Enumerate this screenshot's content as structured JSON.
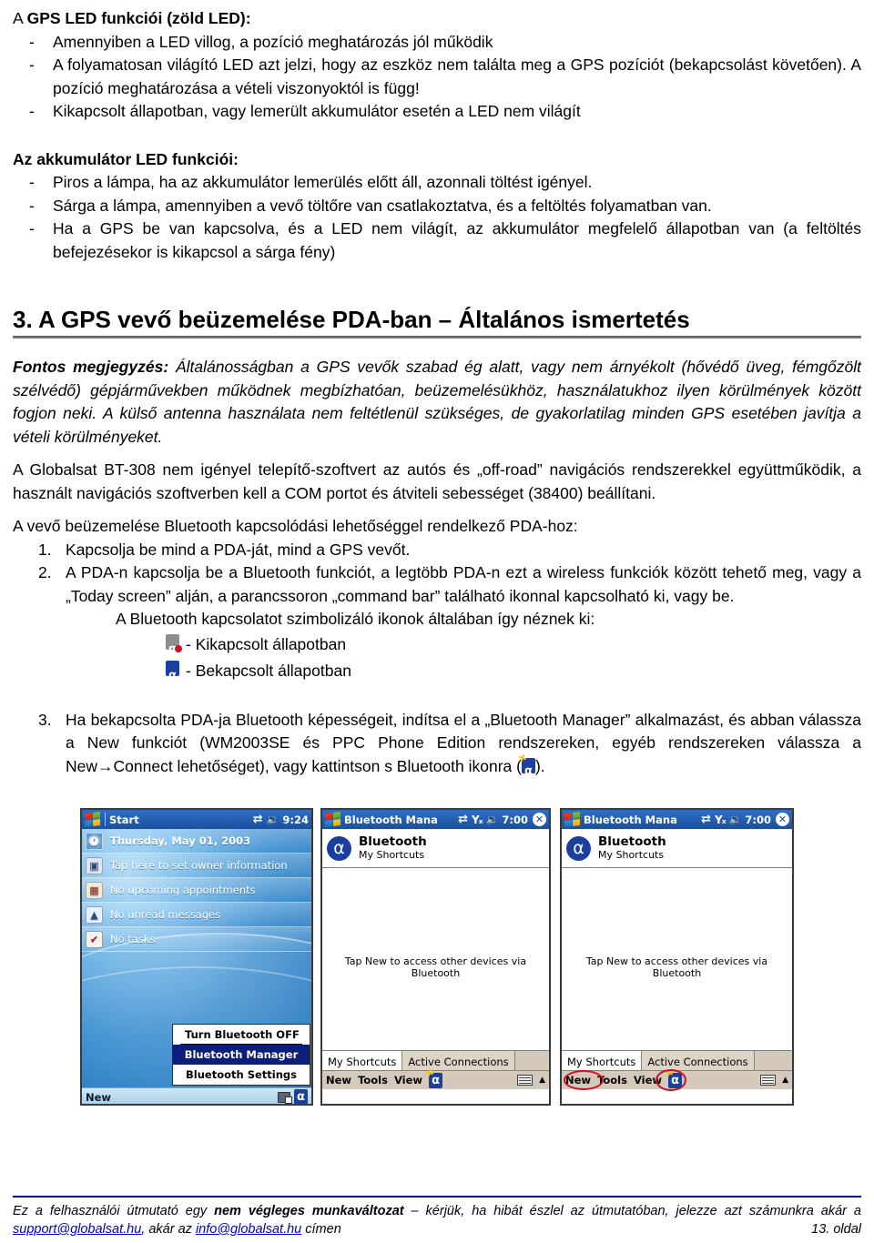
{
  "gps_led": {
    "heading_prefix": "A ",
    "heading_bold": "GPS LED funkciói (zöld LED):",
    "items": [
      "Amennyiben a LED villog, a pozíció meghatározás jól működik",
      "A folyamatosan világító LED azt jelzi, hogy az eszköz nem találta meg a GPS pozíciót (bekapcsolást követően). A pozíció meghatározása a vételi viszonyoktól is függ!",
      "Kikapcsolt állapotban, vagy lemerült akkumulátor esetén a LED nem világít"
    ]
  },
  "battery_led": {
    "heading": "Az akkumulátor LED funkciói:",
    "items": [
      "Piros a lámpa, ha az akkumulátor lemerülés előtt áll, azonnali töltést igényel.",
      "Sárga a lámpa, amennyiben a vevő töltőre van csatlakoztatva, és a feltöltés folyamatban van.",
      "Ha a GPS be van kapcsolva, és a LED nem világít, az akkumulátor megfelelő állapotban van (a feltöltés befejezésekor is kikapcsol a sárga fény)"
    ]
  },
  "section3": {
    "title": "3. A GPS vevő beüzemelése PDA-ban – Általános ismertetés",
    "note_label": "Fontos megjegyzés:",
    "note_body": " Általánosságban a GPS vevők szabad ég alatt, vagy nem árnyékolt (hővédő üveg, fémgőzölt szélvédő) gépjárművekben működnek megbízhatóan, beüzemelésükhöz, használatukhoz ilyen körülmények között fogjon neki. A külső antenna használata nem feltétlenül szükséges, de gyakorlatilag minden GPS esetében javítja a vételi körülményeket.",
    "para2": "A Globalsat BT-308 nem igényel telepítő-szoftvert az autós és „off-road” navigációs rendszerekkel együttműködik, a használt navigációs szoftverben kell a COM portot és átviteli sebességet (38400) beállítani.",
    "para3": "A vevő beüzemelése Bluetooth kapcsolódási lehetőséggel rendelkező PDA-hoz:",
    "steps": [
      {
        "num": "1.",
        "text": "Kapcsolja be mind a PDA-ját, mind a GPS vevőt."
      },
      {
        "num": "2.",
        "text": "A PDA-n kapcsolja be a Bluetooth funkciót, a legtöbb PDA-n ezt a wireless funkciók között tehető meg, vagy a „Today screen” alján, a parancssoron „command bar” található ikonnal kapcsolható ki, vagy be."
      }
    ],
    "icon_intro": "A Bluetooth kapcsolatot szimbolizáló ikonok általában így néznek ki:",
    "icon_rows": [
      {
        "icon": "bluetooth-off-icon",
        "label": "- Kikapcsolt állapotban"
      },
      {
        "icon": "bluetooth-on-icon",
        "label": "- Bekapcsolt állapotban"
      }
    ],
    "step3": {
      "num": "3.",
      "text_a": "Ha bekapcsolta PDA-ja Bluetooth képességeit, indítsa el a „Bluetooth Manager” alkalmazást, és abban válassza a New funkciót (WM2003SE és PPC Phone Edition rendszereken, egyéb rendszereken válassza a New→Connect lehetőséget), vagy kattintson s Bluetooth ikonra (",
      "text_b": ")."
    }
  },
  "pda1": {
    "name": "today-screen",
    "titlebar": {
      "logo": "windows-logo-icon",
      "start": "Start",
      "icons": [
        "sync-icon",
        "speaker-icon"
      ],
      "clock": "9:24"
    },
    "rows": [
      {
        "icon": "clock-icon",
        "label": "Thursday, May 01, 2003"
      },
      {
        "icon": "owner-info-icon",
        "label": "Tap here to set owner information"
      },
      {
        "icon": "calendar-icon",
        "label": "No upcoming appointments"
      },
      {
        "icon": "inbox-icon",
        "label": "No unread messages"
      },
      {
        "icon": "tasks-icon",
        "label": "No tasks"
      }
    ],
    "popup": [
      {
        "label": "Turn Bluetooth OFF",
        "selected": false,
        "sep": true
      },
      {
        "label": "Bluetooth Manager",
        "selected": true,
        "sep": false
      },
      {
        "label": "Bluetooth Settings",
        "selected": false,
        "sep": false
      }
    ],
    "cmdbar": {
      "new": "New",
      "icons": [
        "network-icon",
        "bluetooth-on-icon"
      ]
    }
  },
  "pda2": {
    "name": "bluetooth-manager-screen",
    "titlebar": {
      "title": "Bluetooth Mana",
      "icons": [
        "sync-icon",
        "signal-off-icon",
        "speaker-icon"
      ],
      "clock": "7:00",
      "close": "✕"
    },
    "header": {
      "title": "Bluetooth",
      "subtitle": "My Shortcuts",
      "icon": "bluetooth-on-icon"
    },
    "hint": "Tap New to access other devices via Bluetooth",
    "tabs": [
      {
        "label": "My Shortcuts",
        "active": true
      },
      {
        "label": "Active Connections",
        "active": false
      }
    ],
    "cmdbar": {
      "items": [
        "New",
        "Tools",
        "View"
      ],
      "icon": "bluetooth-spark-icon",
      "keyboard": "keyboard-icon",
      "arrow": "▲"
    },
    "rings": []
  },
  "pda3": {
    "name": "bluetooth-manager-screen-annotated",
    "titlebar": {
      "title": "Bluetooth Mana",
      "icons": [
        "sync-icon",
        "signal-off-icon",
        "speaker-icon"
      ],
      "clock": "7:00",
      "close": "✕"
    },
    "header": {
      "title": "Bluetooth",
      "subtitle": "My Shortcuts",
      "icon": "bluetooth-on-icon"
    },
    "hint": "Tap New to access other devices via Bluetooth",
    "tabs": [
      {
        "label": "My Shortcuts",
        "active": true
      },
      {
        "label": "Active Connections",
        "active": false
      }
    ],
    "cmdbar": {
      "items": [
        "New",
        "Tools",
        "View"
      ],
      "icon": "bluetooth-spark-icon",
      "keyboard": "keyboard-icon",
      "arrow": "▲"
    },
    "rings": [
      "new-highlight",
      "bluetooth-icon-highlight"
    ]
  },
  "footer": {
    "text_a": "Ez a felhasználói útmutató egy ",
    "text_bold": "nem végleges munkaváltozat",
    "text_b": " – kérjük, ha hibát észlel az útmutatóban, jelezze azt számunkra akár a ",
    "email1": "support@globalsat.hu",
    "text_c": ", akár az ",
    "email2": "info@globalsat.hu",
    "text_d": " címen",
    "page": "13. oldal"
  },
  "colors": {
    "accent_blue": "#1a3fa0",
    "title_gradient_top": "#2f6fc4",
    "title_gradient_bottom": "#1b4f9e",
    "ring_red": "#cc1122",
    "link_blue": "#0000cc",
    "rule_grey": "#7a7a7a"
  }
}
